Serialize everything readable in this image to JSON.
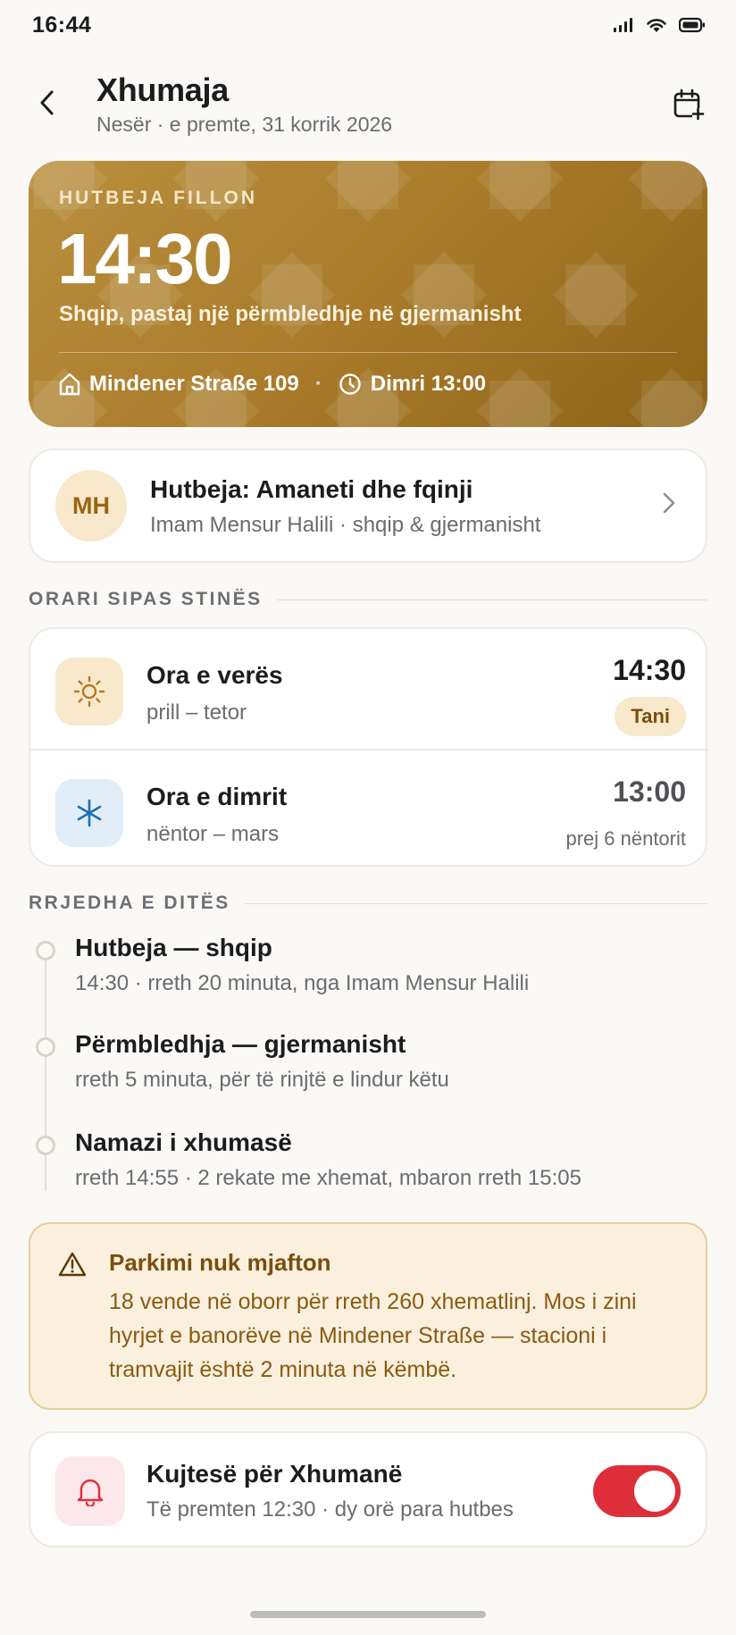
{
  "status": {
    "time": "16:44"
  },
  "header": {
    "title": "Xhumaja",
    "subtitle": "Nesër · e premte, 31 korrik 2026"
  },
  "hero": {
    "label": "HUTBEJA FILLON",
    "time": "14:30",
    "description": "Shqip, pastaj një përmbledhje në gjermanisht",
    "address": "Mindener Straße 109",
    "separator": "·",
    "winter_time": "Dimri 13:00"
  },
  "sermon": {
    "initials": "MH",
    "title": "Hutbeja: Amaneti dhe fqinji",
    "subtitle": "Imam Mensur Halili · shqip & gjermanisht"
  },
  "schedule": {
    "section_title": "ORARI SIPAS STINËS",
    "rows": [
      {
        "label": "Ora e verës",
        "months": "prill – tetor",
        "time": "14:30",
        "badge": "Tani"
      },
      {
        "label": "Ora e dimrit",
        "months": "nëntor – mars",
        "time": "13:00",
        "note": "prej 6 nëntorit"
      }
    ]
  },
  "timeline": {
    "section_title": "RRJEDHA E DITËS",
    "items": [
      {
        "title": "Hutbeja — shqip",
        "subtitle": "14:30 · rreth 20 minuta, nga Imam Mensur Halili"
      },
      {
        "title": "Përmbledhja — gjermanisht",
        "subtitle": "rreth 5 minuta, për të rinjtë e lindur këtu"
      },
      {
        "title": "Namazi i xhumasë",
        "subtitle": "rreth 14:55 · 2 rekate me xhemat, mbaron rreth 15:05"
      }
    ]
  },
  "warning": {
    "title": "Parkimi nuk mjafton",
    "body": "18 vende në oborr për rreth 260 xhematlinj. Mos i zini hyrjet e banorëve në Mindener Straße — stacioni i tramvajit është 2 minuta në këmbë."
  },
  "reminder": {
    "title": "Kujtesë për Xhumanë",
    "subtitle": "Të premten 12:30 · dy orë para hutbes",
    "enabled": true
  },
  "colors": {
    "accent_gold": "#A97B2A",
    "toggle_red": "#DD2E3A",
    "warning_bg": "#FBF0DE"
  },
  "icons": [
    "signal-icon",
    "wifi-icon",
    "battery-icon",
    "back-arrow-icon",
    "calendar-add-icon",
    "home-icon",
    "clock-icon",
    "chevron-right-icon",
    "sun-icon",
    "snowflake-icon",
    "warning-icon",
    "bell-icon"
  ]
}
